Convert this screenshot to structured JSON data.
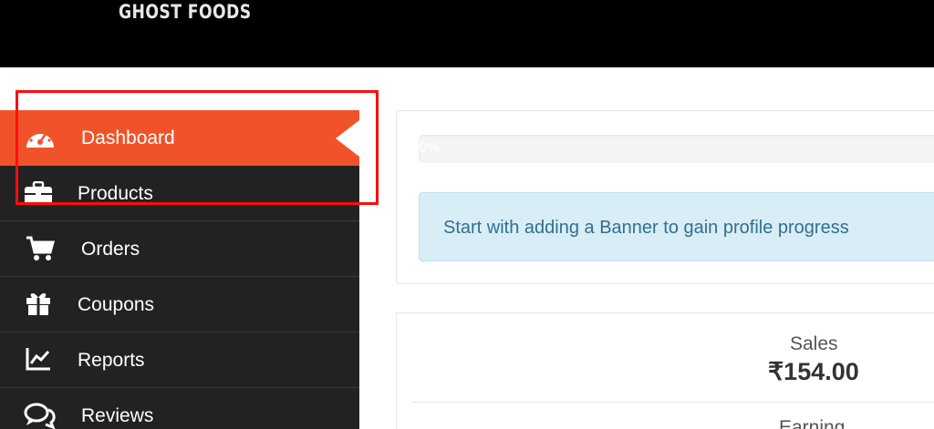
{
  "header": {
    "brand": "GHOST FOODS"
  },
  "sidebar": {
    "items": [
      {
        "label": "Dashboard",
        "icon": "dashboard-gauge-icon",
        "active": true
      },
      {
        "label": "Products",
        "icon": "briefcase-icon"
      },
      {
        "label": "Orders",
        "icon": "shopping-cart-icon"
      },
      {
        "label": "Coupons",
        "icon": "gift-icon"
      },
      {
        "label": "Reports",
        "icon": "line-chart-icon"
      },
      {
        "label": "Reviews",
        "icon": "comments-icon"
      }
    ]
  },
  "profile": {
    "progress_text": "0%",
    "progress_value": 0,
    "banner_message": "Start with adding a Banner to gain profile progress"
  },
  "stats": {
    "sales_label": "Sales",
    "sales_value": "₹154.00",
    "earning_label": "Earning"
  },
  "colors": {
    "accent": "#f0532a",
    "sidebar_bg": "#222222",
    "topbar_bg": "#000000",
    "alert_bg": "#d9edf7",
    "alert_text": "#31708f",
    "annotation": "#ff0d0d"
  }
}
